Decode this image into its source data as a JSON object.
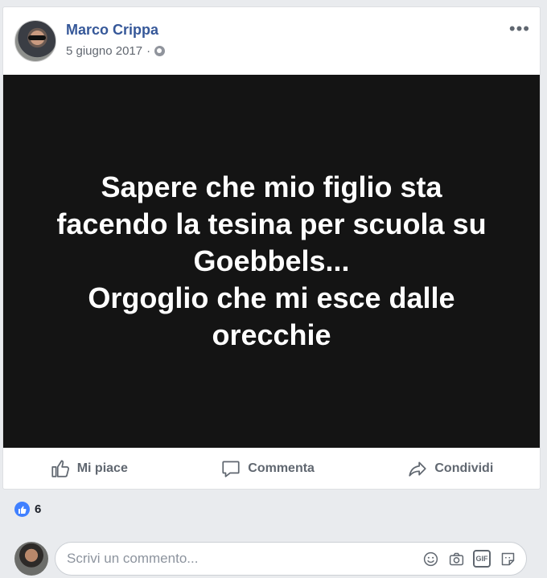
{
  "post": {
    "author": "Marco Crippa",
    "date": "5 giugno 2017",
    "date_separator": "·",
    "more_label": "•••",
    "text": "Sapere che mio figlio sta\nfacendo la tesina per scuola su\nGoebbels...\nOrgoglio che mi esce dalle\norecchie"
  },
  "actions": {
    "like": "Mi piace",
    "comment": "Commenta",
    "share": "Condividi"
  },
  "reactions": {
    "count": "6"
  },
  "comment_box": {
    "placeholder": "Scrivi un commento...",
    "gif_label": "GIF"
  },
  "colors": {
    "author_link": "#365899",
    "image_background": "#141414",
    "reaction_blue": "#4080ff"
  }
}
